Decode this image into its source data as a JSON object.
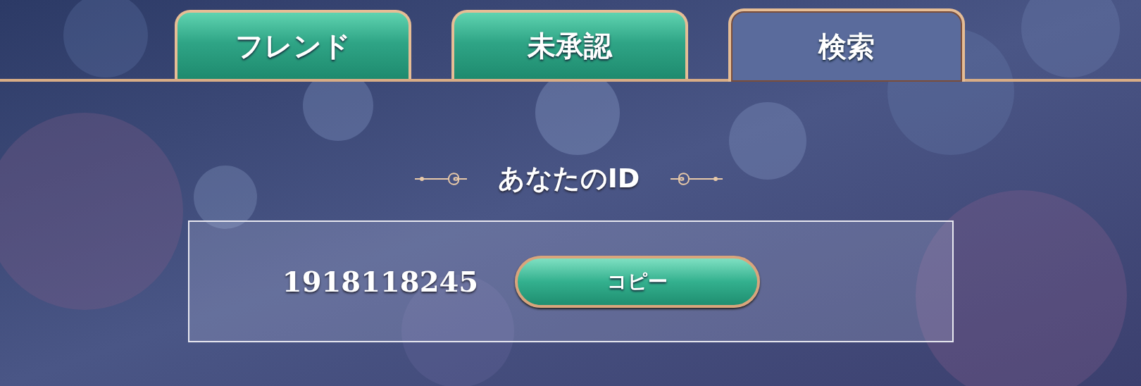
{
  "tabs": [
    {
      "label": "フレンド",
      "selected": false
    },
    {
      "label": "未承認",
      "selected": false
    },
    {
      "label": "検索",
      "selected": true
    }
  ],
  "id_section": {
    "heading": "あなたのID",
    "id_value": "1918118245",
    "copy_button": "コピー"
  }
}
